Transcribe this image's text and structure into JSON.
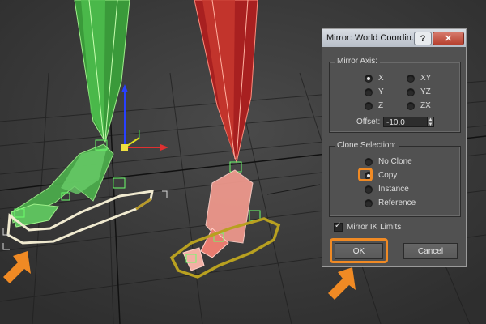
{
  "dialog": {
    "title": "Mirror: World Coordin...",
    "help_button": "?",
    "close_button": "✕",
    "mirror_axis": {
      "title": "Mirror Axis:",
      "options": [
        {
          "label": "X",
          "selected": true
        },
        {
          "label": "XY",
          "selected": false
        },
        {
          "label": "Y",
          "selected": false
        },
        {
          "label": "YZ",
          "selected": false
        },
        {
          "label": "Z",
          "selected": false
        },
        {
          "label": "ZX",
          "selected": false
        }
      ],
      "offset_label": "Offset:",
      "offset_value": "-10.0"
    },
    "clone_selection": {
      "title": "Clone Selection:",
      "options": [
        {
          "label": "No Clone",
          "selected": false
        },
        {
          "label": "Copy",
          "selected": true
        },
        {
          "label": "Instance",
          "selected": false
        },
        {
          "label": "Reference",
          "selected": false
        }
      ]
    },
    "mirror_ik_limits": {
      "label": "Mirror IK Limits",
      "checked": true
    },
    "ok_label": "OK",
    "cancel_label": "Cancel"
  },
  "colors": {
    "highlight": "#f08a24",
    "left_leg": "#3fae3f",
    "right_leg": "#c8302a",
    "mirrored_foot": "#f29a8e",
    "foot_outline": "#b8a020"
  }
}
